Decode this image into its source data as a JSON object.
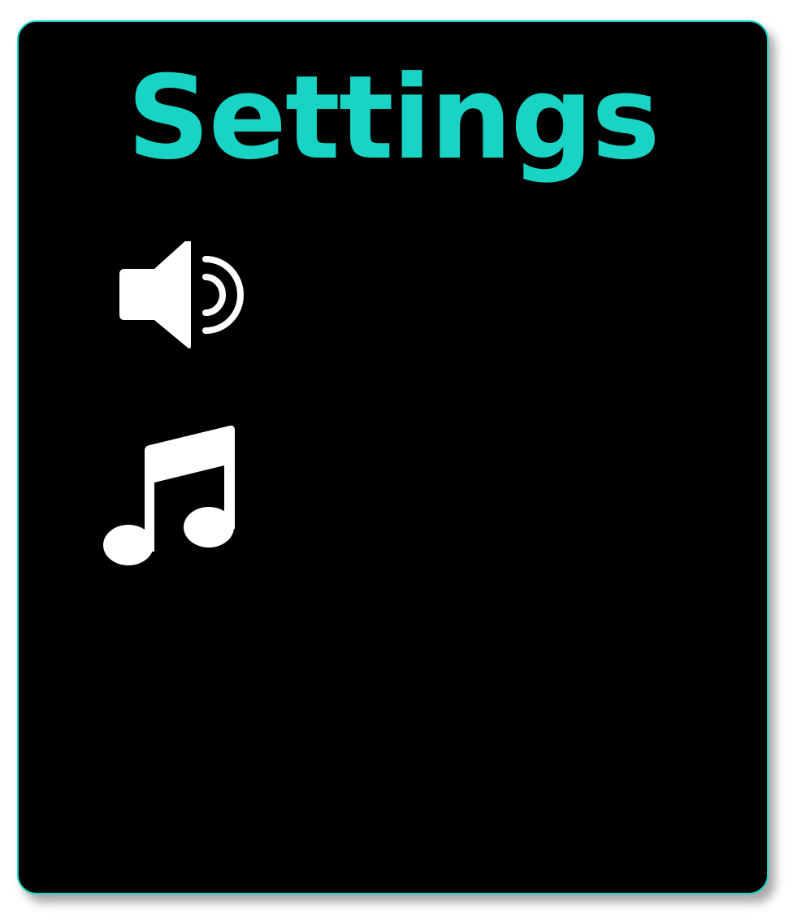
{
  "title": "Settings",
  "colors": {
    "accent": "#19d3c5",
    "background": "#000000",
    "icon": "#ffffff"
  },
  "settings": [
    {
      "id": "sound",
      "icon": "speaker-icon"
    },
    {
      "id": "music",
      "icon": "music-note-icon"
    }
  ]
}
